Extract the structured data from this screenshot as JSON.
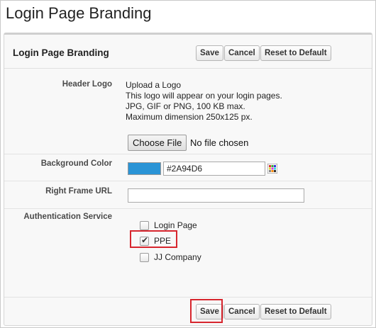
{
  "page": {
    "title": "Login Page Branding"
  },
  "panel": {
    "title": "Login Page Branding",
    "buttons": {
      "save": "Save",
      "cancel": "Cancel",
      "reset": "Reset to Default"
    }
  },
  "header_logo": {
    "label": "Header Logo",
    "line1": "Upload a Logo",
    "line2": "This logo will appear on your login pages.",
    "line3": "JPG, GIF or PNG, 100 KB max.",
    "line4": "Maximum dimension 250x125 px.",
    "choose_file": "Choose File",
    "file_status": "No file chosen"
  },
  "background_color": {
    "label": "Background Color",
    "value": "#2A94D6",
    "swatch_color": "#2A94D6",
    "icon": "color-palette-icon"
  },
  "right_frame_url": {
    "label": "Right Frame URL",
    "value": ""
  },
  "authentication_service": {
    "label": "Authentication Service",
    "options": [
      {
        "label": "Login Page",
        "checked": false
      },
      {
        "label": "PPE",
        "checked": true
      },
      {
        "label": "JJ Company",
        "checked": false
      }
    ]
  },
  "highlight_color": "#D7262E"
}
